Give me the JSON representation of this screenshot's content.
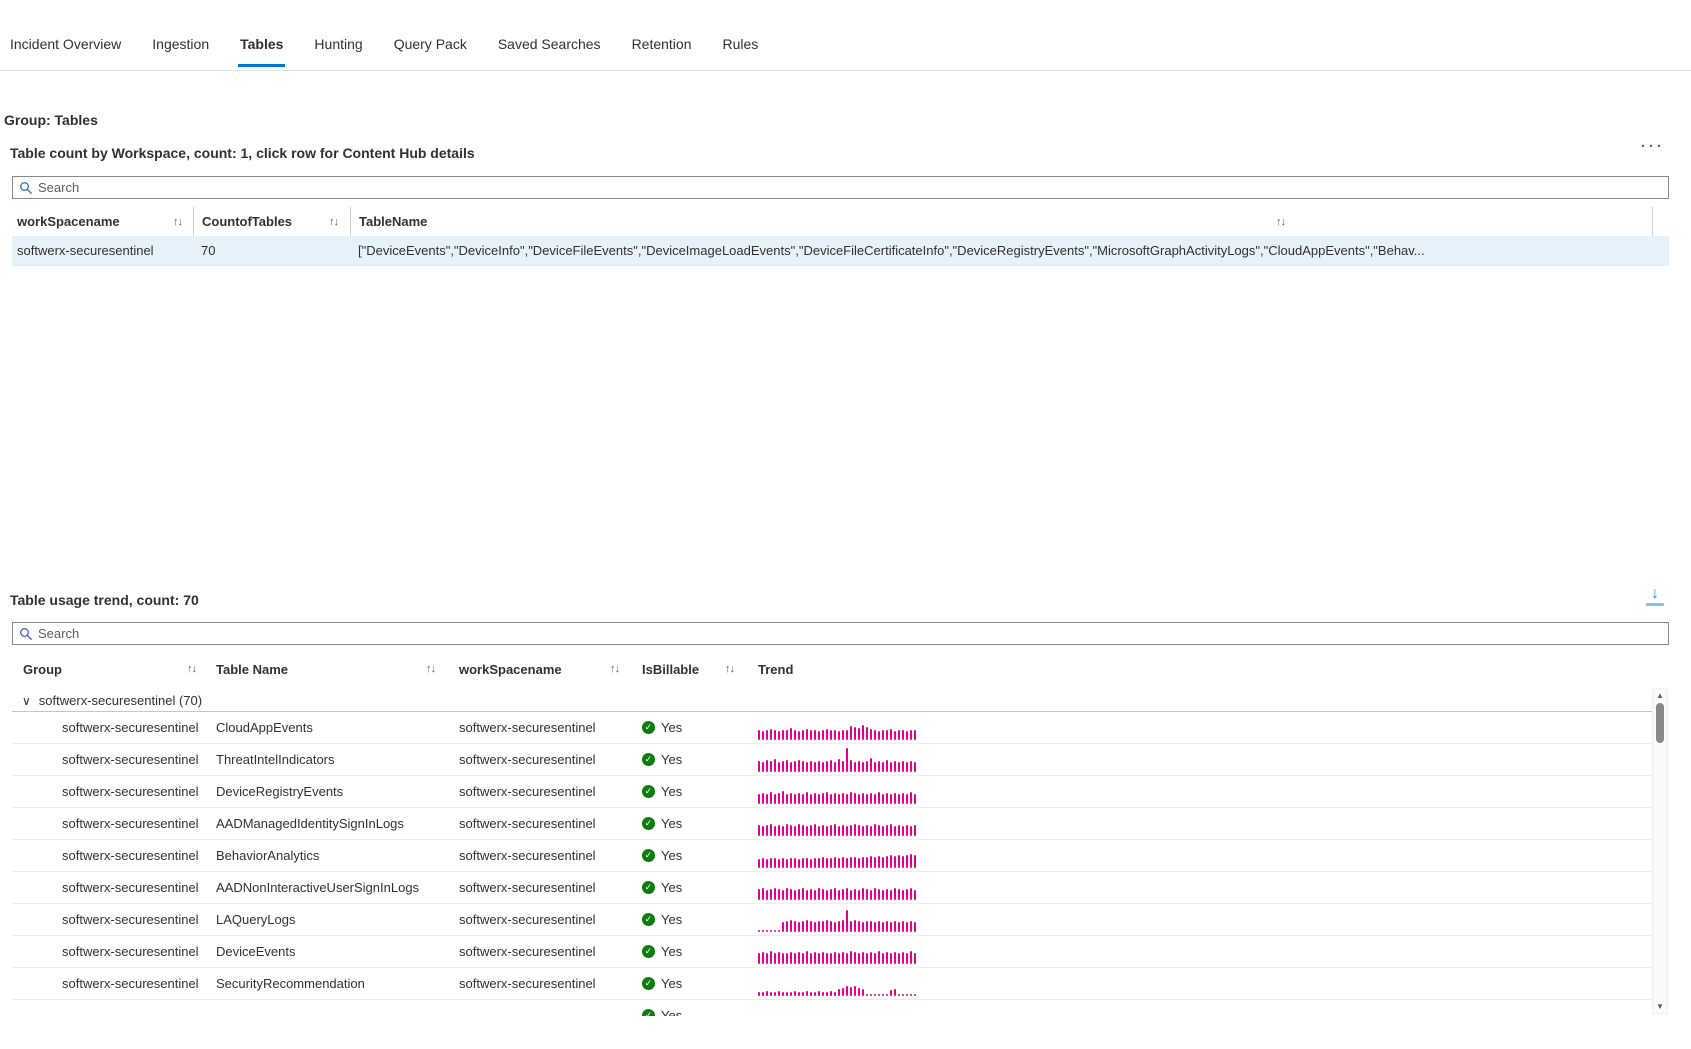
{
  "tabs": [
    {
      "label": "Incident Overview",
      "selected": false
    },
    {
      "label": "Ingestion",
      "selected": false
    },
    {
      "label": "Tables",
      "selected": true
    },
    {
      "label": "Hunting",
      "selected": false
    },
    {
      "label": "Query Pack",
      "selected": false
    },
    {
      "label": "Saved Searches",
      "selected": false
    },
    {
      "label": "Retention",
      "selected": false
    },
    {
      "label": "Rules",
      "selected": false
    }
  ],
  "group_heading": "Group: Tables",
  "table_count": {
    "title": "Table count by Workspace, count: 1, click row for Content Hub details",
    "search_placeholder": "Search",
    "columns": [
      "workSpacename",
      "CountofTables",
      "TableName"
    ],
    "row": {
      "workSpacename": "softwerx-securesentinel",
      "CountofTables": "70",
      "TableName": "[\"DeviceEvents\",\"DeviceInfo\",\"DeviceFileEvents\",\"DeviceImageLoadEvents\",\"DeviceFileCertificateInfo\",\"DeviceRegistryEvents\",\"MicrosoftGraphActivityLogs\",\"CloudAppEvents\",\"Behav..."
    }
  },
  "usage": {
    "title": "Table usage trend, count: 70",
    "search_placeholder": "Search",
    "columns": [
      "Group",
      "Table Name",
      "workSpacename",
      "IsBillable",
      "Trend"
    ],
    "group_row_label": "softwerx-securesentinel (70)",
    "rows": [
      {
        "group": "softwerx-securesentinel",
        "table": "CloudAppEvents",
        "workspace": "softwerx-securesentinel",
        "billable": "Yes",
        "trend": [
          10,
          9,
          10,
          11,
          10,
          9,
          10,
          10,
          12,
          10,
          9,
          10,
          11,
          10,
          10,
          9,
          10,
          11,
          10,
          10,
          9,
          10,
          10,
          14,
          13,
          12,
          15,
          13,
          11,
          10,
          9,
          10,
          10,
          11,
          9,
          10,
          10,
          9,
          10,
          10
        ]
      },
      {
        "group": "softwerx-securesentinel",
        "table": "ThreatIntelIndicators",
        "workspace": "softwerx-securesentinel",
        "billable": "Yes",
        "trend": [
          11,
          10,
          12,
          11,
          13,
          10,
          11,
          12,
          10,
          11,
          12,
          11,
          10,
          11,
          10,
          11,
          10,
          11,
          12,
          10,
          13,
          11,
          24,
          12,
          10,
          11,
          10,
          11,
          14,
          10,
          11,
          10,
          12,
          10,
          11,
          10,
          11,
          10,
          11,
          10
        ]
      },
      {
        "group": "softwerx-securesentinel",
        "table": "DeviceRegistryEvents",
        "workspace": "softwerx-securesentinel",
        "billable": "Yes",
        "trend": [
          10,
          11,
          10,
          12,
          10,
          11,
          13,
          10,
          11,
          10,
          11,
          10,
          12,
          10,
          11,
          10,
          11,
          12,
          10,
          11,
          10,
          11,
          10,
          12,
          11,
          10,
          11,
          10,
          11,
          10,
          12,
          10,
          11,
          10,
          11,
          10,
          11,
          10,
          12,
          10
        ]
      },
      {
        "group": "softwerx-securesentinel",
        "table": "AADManagedIdentitySignInLogs",
        "workspace": "softwerx-securesentinel",
        "billable": "Yes",
        "trend": [
          11,
          10,
          11,
          12,
          10,
          11,
          10,
          12,
          11,
          10,
          12,
          11,
          10,
          11,
          12,
          10,
          11,
          10,
          11,
          12,
          10,
          11,
          10,
          11,
          12,
          11,
          10,
          11,
          10,
          12,
          11,
          10,
          11,
          12,
          10,
          11,
          10,
          11,
          10,
          11
        ]
      },
      {
        "group": "softwerx-securesentinel",
        "table": "BehaviorAnalytics",
        "workspace": "softwerx-securesentinel",
        "billable": "Yes",
        "trend": [
          9,
          10,
          9,
          10,
          10,
          9,
          10,
          9,
          10,
          10,
          9,
          10,
          10,
          9,
          10,
          10,
          11,
          10,
          10,
          11,
          10,
          11,
          10,
          11,
          11,
          10,
          11,
          11,
          12,
          11,
          12,
          11,
          12,
          13,
          12,
          13,
          12,
          13,
          14,
          13
        ]
      },
      {
        "group": "softwerx-securesentinel",
        "table": "AADNonInteractiveUserSignInLogs",
        "workspace": "softwerx-securesentinel",
        "billable": "Yes",
        "trend": [
          11,
          12,
          10,
          11,
          12,
          11,
          10,
          12,
          11,
          10,
          11,
          12,
          10,
          11,
          10,
          12,
          11,
          10,
          11,
          12,
          10,
          11,
          12,
          10,
          11,
          10,
          12,
          11,
          10,
          12,
          11,
          10,
          11,
          10,
          12,
          11,
          10,
          11,
          12,
          10
        ]
      },
      {
        "group": "softwerx-securesentinel",
        "table": "LAQueryLogs",
        "workspace": "softwerx-securesentinel",
        "billable": "Yes",
        "trend": [
          2,
          2,
          2,
          2,
          2,
          2,
          10,
          11,
          12,
          11,
          10,
          11,
          12,
          11,
          10,
          11,
          11,
          12,
          11,
          10,
          11,
          12,
          22,
          11,
          12,
          11,
          10,
          11,
          11,
          10,
          11,
          10,
          11,
          10,
          11,
          10,
          11,
          10,
          11,
          10
        ]
      },
      {
        "group": "softwerx-securesentinel",
        "table": "DeviceEvents",
        "workspace": "softwerx-securesentinel",
        "billable": "Yes",
        "trend": [
          11,
          12,
          11,
          13,
          11,
          12,
          11,
          11,
          12,
          11,
          12,
          11,
          13,
          11,
          12,
          11,
          12,
          11,
          11,
          12,
          11,
          12,
          11,
          13,
          12,
          11,
          12,
          11,
          12,
          11,
          13,
          11,
          12,
          11,
          12,
          11,
          12,
          11,
          13,
          11
        ]
      },
      {
        "group": "softwerx-securesentinel",
        "table": "SecurityRecommendation",
        "workspace": "softwerx-securesentinel",
        "billable": "Yes",
        "trend": [
          4,
          4,
          5,
          4,
          4,
          5,
          4,
          4,
          4,
          5,
          4,
          4,
          5,
          4,
          4,
          5,
          4,
          4,
          5,
          4,
          7,
          8,
          10,
          9,
          10,
          8,
          7,
          2,
          2,
          2,
          2,
          2,
          2,
          6,
          7,
          2,
          2,
          2,
          2,
          2
        ]
      }
    ],
    "partial_row": {
      "billable": "Yes"
    }
  },
  "icons": {
    "sort": "↑↓",
    "chevron_down": "∨",
    "more": "···",
    "download_arrow": "↓",
    "check": "✓",
    "scroll_up": "▲",
    "scroll_down": "▼"
  },
  "colors": {
    "accent": "#0078d4",
    "trend": "#e3008c",
    "billable_green": "#107c10",
    "selected_row": "#e6f2fa"
  }
}
